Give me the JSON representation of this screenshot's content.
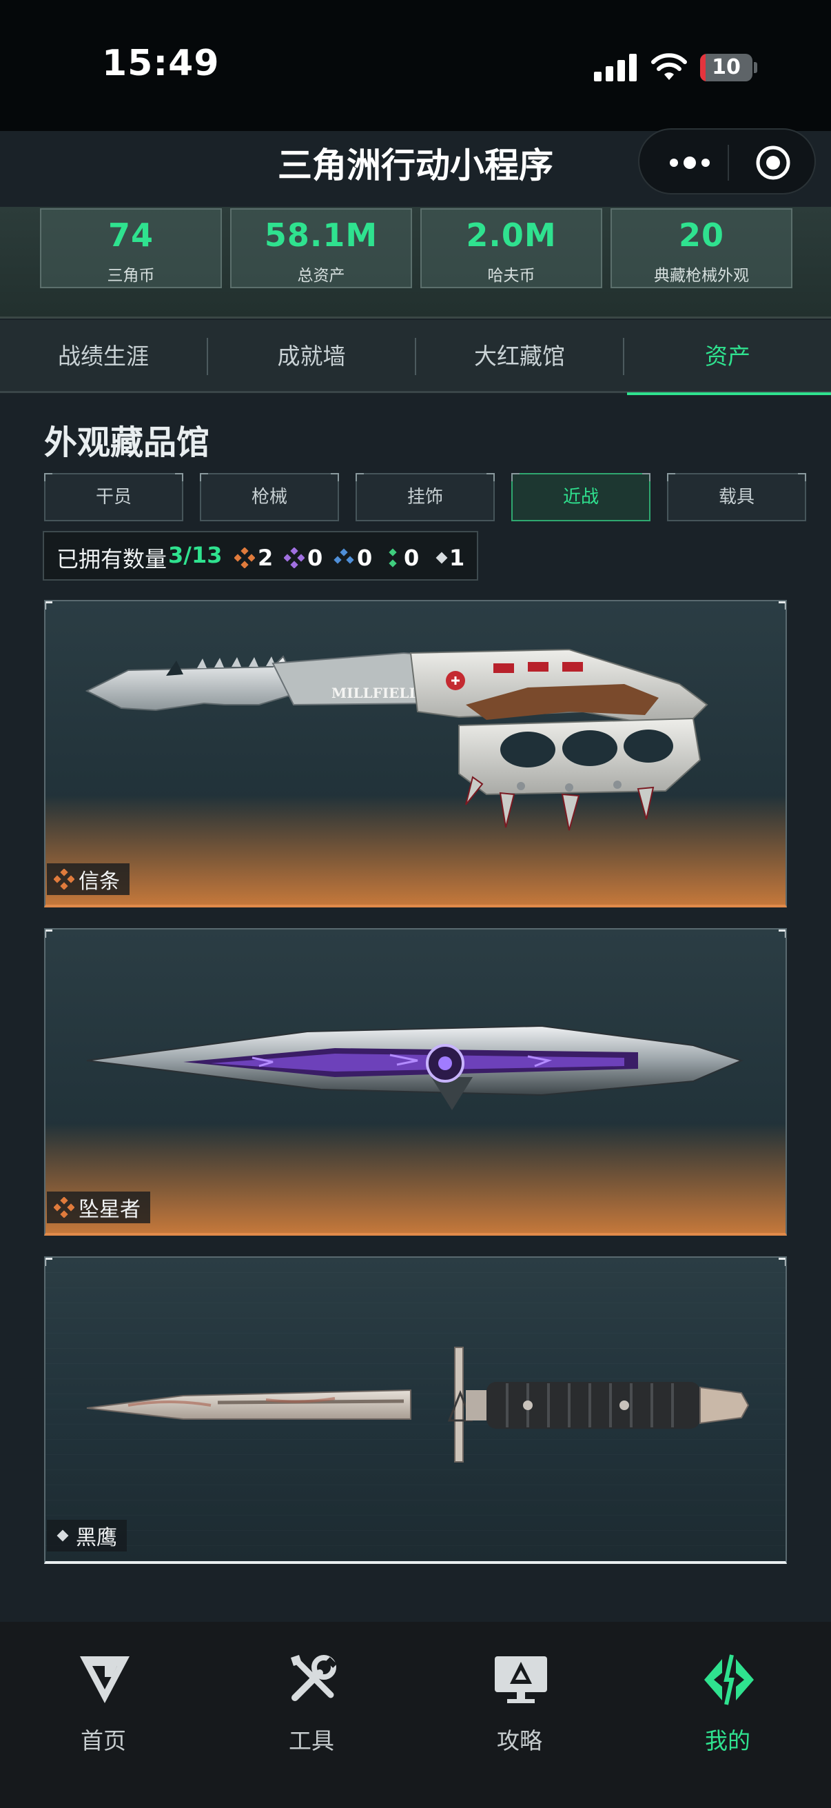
{
  "status_bar": {
    "time": "15:49",
    "battery": "10",
    "battery_level": 0.1
  },
  "header": {
    "title": "三角洲行动小程序"
  },
  "stats": [
    {
      "value": "74",
      "label": "三角币"
    },
    {
      "value": "58.1M",
      "label": "总资产"
    },
    {
      "value": "2.0M",
      "label": "哈夫币"
    },
    {
      "value": "20",
      "label": "典藏枪械外观"
    }
  ],
  "main_tabs": [
    {
      "label": "战绩生涯",
      "active": false
    },
    {
      "label": "成就墙",
      "active": false
    },
    {
      "label": "大红藏馆",
      "active": false
    },
    {
      "label": "资产",
      "active": true
    }
  ],
  "section": {
    "title": "外观藏品馆"
  },
  "sub_tabs": [
    {
      "label": "干员",
      "active": false
    },
    {
      "label": "枪械",
      "active": false
    },
    {
      "label": "挂饰",
      "active": false
    },
    {
      "label": "近战",
      "active": true
    },
    {
      "label": "载具",
      "active": false
    }
  ],
  "owned": {
    "label": "已拥有数量",
    "count": "3/13",
    "rarities": [
      {
        "icon": "orange-rarity-icon",
        "color": "#e07b3c",
        "count": "2"
      },
      {
        "icon": "purple-rarity-icon",
        "color": "#a070e0",
        "count": "0"
      },
      {
        "icon": "blue-rarity-icon",
        "color": "#4f8fd8",
        "count": "0"
      },
      {
        "icon": "green-rarity-icon",
        "color": "#3fce7e",
        "count": "0"
      },
      {
        "icon": "white-rarity-icon",
        "color": "#d8dde0",
        "count": "1"
      }
    ]
  },
  "items": [
    {
      "name": "信条",
      "rarity": "orange"
    },
    {
      "name": "坠星者",
      "rarity": "orange"
    },
    {
      "name": "黑鹰",
      "rarity": "white"
    }
  ],
  "bottom_nav": [
    {
      "label": "首页",
      "icon": "home-logo-icon",
      "active": false
    },
    {
      "label": "工具",
      "icon": "tools-icon",
      "active": false
    },
    {
      "label": "攻略",
      "icon": "guide-monitor-icon",
      "active": false
    },
    {
      "label": "我的",
      "icon": "profile-diamond-icon",
      "active": true
    }
  ],
  "colors": {
    "accent": "#2fe28f",
    "orange_rarity": "#e08a4a",
    "background": "#1a2228"
  }
}
